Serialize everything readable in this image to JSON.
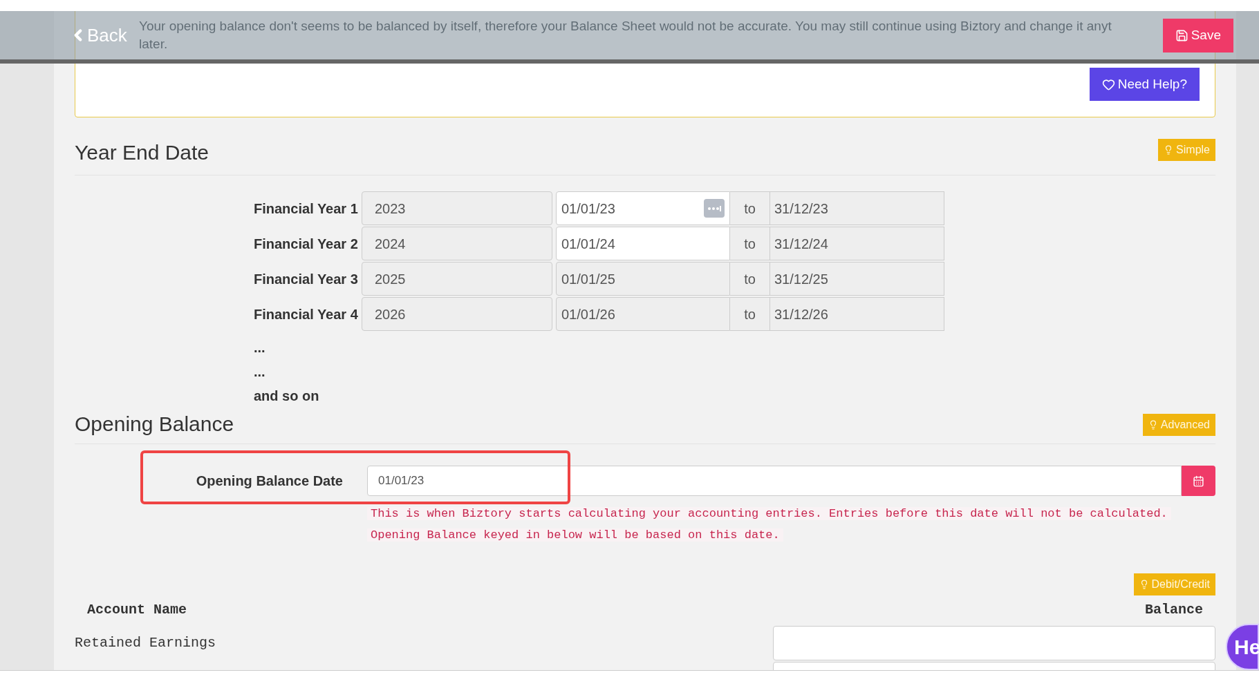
{
  "top_bar": {
    "back": "Back",
    "save": "Save"
  },
  "alert": {
    "lines": [
      "Your opening balance don't seems to be balanced by itself, therefore your Balance Sheet would not be accurate. You may still continue using Biztory and change it anyt",
      "later."
    ],
    "help": "Need Help?"
  },
  "year_end": {
    "title": "Year End Date",
    "mode": "Simple",
    "rows": [
      {
        "label": "Financial Year 1",
        "year": "2023",
        "start": "01/01/23",
        "start_editable": true,
        "picker": true,
        "to": "to",
        "end": "31/12/23"
      },
      {
        "label": "Financial Year 2",
        "year": "2024",
        "start": "01/01/24",
        "start_editable": true,
        "picker": false,
        "to": "to",
        "end": "31/12/24"
      },
      {
        "label": "Financial Year 3",
        "year": "2025",
        "start": "01/01/25",
        "start_editable": false,
        "picker": false,
        "to": "to",
        "end": "31/12/25"
      },
      {
        "label": "Financial Year 4",
        "year": "2026",
        "start": "01/01/26",
        "start_editable": false,
        "picker": false,
        "to": "to",
        "end": "31/12/26"
      }
    ],
    "notes": [
      "...",
      "...",
      "and so on"
    ]
  },
  "opening_balance": {
    "title": "Opening Balance",
    "mode": "Advanced",
    "date_label": "Opening Balance Date",
    "date_value": "01/01/23",
    "help_lines": [
      "This is when Biztory starts calculating your accounting entries. Entries before this date will not be calculated.",
      "Opening Balance keyed in below will be based on this date."
    ],
    "toggle": "Debit/Credit",
    "columns": [
      "Account Name",
      "Balance"
    ],
    "rows": [
      {
        "name": "Retained Earnings"
      }
    ]
  },
  "chat": {
    "label": "He"
  }
}
